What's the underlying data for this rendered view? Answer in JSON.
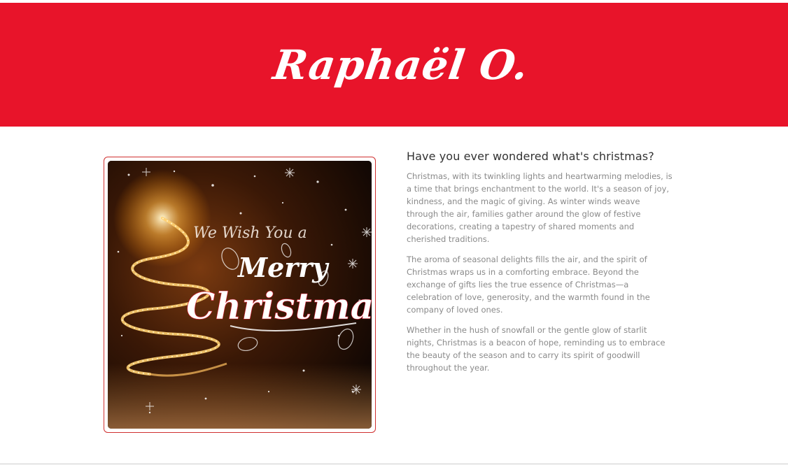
{
  "header": {
    "logo_text": "Raphaël O.",
    "background_color": "#e8142a"
  },
  "feature": {
    "image": {
      "icon": "merry-christmas-card-image",
      "line1": "We Wish You a",
      "line2": "Merry",
      "line3": "Christmas"
    },
    "heading": "Have you ever wondered what's christmas?",
    "paragraphs": [
      "Christmas, with its twinkling lights and heartwarming melodies, is a time that brings enchantment to the world. It's a season of joy, kindness, and the magic of giving. As winter winds weave through the air, families gather around the glow of festive decorations, creating a tapestry of shared moments and cherished traditions.",
      "The aroma of seasonal delights fills the air, and the spirit of Christmas wraps us in a comforting embrace. Beyond the exchange of gifts lies the true essence of Christmas—a celebration of love, generosity, and the warmth found in the company of loved ones.",
      "Whether in the hush of snowfall or the gentle glow of starlit nights, Christmas is a beacon of hope, reminding us to embrace the beauty of the season and to carry its spirit of goodwill throughout the year."
    ]
  }
}
